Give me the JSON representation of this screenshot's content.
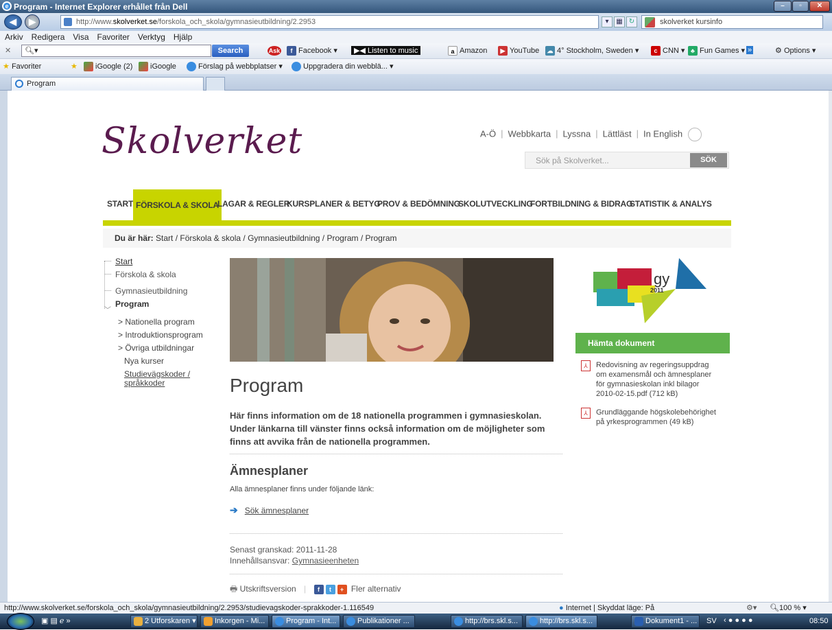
{
  "window": {
    "title": "Program - Internet Explorer erhållet från Dell"
  },
  "address": {
    "url_prefix": "http://www.",
    "url_domain": "skolverket.se",
    "url_path": "/forskola_och_skola/gymnasieutbildning/2.2953",
    "search_text": "skolverket kursinfo"
  },
  "menubar": [
    "Arkiv",
    "Redigera",
    "Visa",
    "Favoriter",
    "Verktyg",
    "Hjälp"
  ],
  "toolbar": {
    "search_button": "Search",
    "items": [
      "Facebook ▾",
      "Listen to music",
      "Amazon",
      "YouTube",
      "4° Stockholm, Sweden ▾",
      "CNN ▾",
      "Fun Games ▾",
      "»"
    ],
    "options": "Options ▾"
  },
  "favbar": {
    "favorites": "Favoriter",
    "items": [
      "iGoogle (2)",
      "iGoogle",
      "Förslag på webbplatser ▾",
      "Uppgradera din webblä... ▾"
    ]
  },
  "tab": {
    "label": "Program"
  },
  "site": {
    "logo": "Skolverket",
    "toplinks": [
      "A-Ö",
      "Webbkarta",
      "Lyssna",
      "Lättläst",
      "In English"
    ],
    "search_placeholder": "Sök på Skolverket...",
    "search_button": "SÖK",
    "nav": [
      "START",
      "FÖRSKOLA & SKOLA",
      "LAGAR & REGLER",
      "KURSPLANER & BETYG",
      "PROV & BEDÖMNING",
      "SKOLUTVECKLING",
      "FORTBILDNING & BIDRAG",
      "STATISTIK & ANALYS"
    ],
    "active_nav_index": 1,
    "breadcrumb_label": "Du är här:",
    "breadcrumb": "Start / Förskola & skola / Gymnasieutbildning / Program / Program",
    "sidenav": {
      "start": "Start",
      "forskola": "Förskola & skola",
      "gymnasie": "Gymnasieutbildning",
      "program": "Program",
      "nationella": "> Nationella program",
      "intro": "> Introduktionsprogram",
      "ovriga": "> Övriga utbildningar",
      "nya": "Nya kurser",
      "koder1": "Studievägskoder /",
      "koder2": "språkkoder"
    },
    "heading": "Program",
    "intro": "Här finns information om de 18 nationella programmen i gymnasieskolan. Under länkarna till vänster finns också information om de möjligheter som finns att avvika från de nationella programmen.",
    "subheading": "Ämnesplaner",
    "subtext": "Alla ämnesplaner finns under följande länk:",
    "sok_link": "Sök ämnesplaner",
    "reviewed": "Senast granskad: 2011-11-28",
    "responsible_label": "Innehållsansvar:",
    "responsible": "Gymnasieenheten",
    "print": "Utskriftsversion",
    "more": "Fler alternativ",
    "gy_logo_text": "gy",
    "gy_logo_year": "2011",
    "documents_header": "Hämta dokument",
    "documents": [
      "Redovisning av regeringsuppdrag om examensmål och ämnesplaner för gymnasieskolan inkl bilagor 2010-02-15.pdf (712 kB)",
      "Grundläggande högskolebehörighet på yrkesprogrammen (49 kB)"
    ]
  },
  "status": {
    "url": "http://www.skolverket.se/forskola_och_skola/gymnasieutbildning/2.2953/studievagskoder-sprakkoder-1.116549",
    "zone": "Internet | Skyddat läge: På",
    "zoom": "100 %"
  },
  "taskbar": {
    "items": [
      "2 Utforskaren",
      "Inkorgen - Mi...",
      "Program - Int...",
      "Publikationer ...",
      "http://brs.skl.s...",
      "http://brs.skl.s...",
      "Dokument1 - ..."
    ],
    "lang": "SV",
    "clock": "08:50"
  },
  "colors": {
    "accent": "#c8d400",
    "logo": "#5a1b4e",
    "green": "#5fb24c"
  }
}
